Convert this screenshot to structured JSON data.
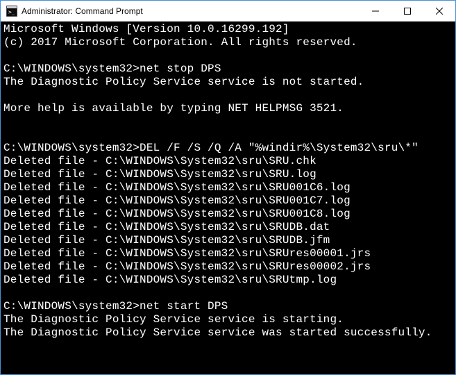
{
  "window": {
    "title": "Administrator: Command Prompt",
    "icon_alt": "cmd-icon"
  },
  "terminal": {
    "lines": [
      "Microsoft Windows [Version 10.0.16299.192]",
      "(c) 2017 Microsoft Corporation. All rights reserved.",
      "",
      "C:\\WINDOWS\\system32>net stop DPS",
      "The Diagnostic Policy Service service is not started.",
      "",
      "More help is available by typing NET HELPMSG 3521.",
      "",
      "",
      "C:\\WINDOWS\\system32>DEL /F /S /Q /A \"%windir%\\System32\\sru\\*\"",
      "Deleted file - C:\\WINDOWS\\System32\\sru\\SRU.chk",
      "Deleted file - C:\\WINDOWS\\System32\\sru\\SRU.log",
      "Deleted file - C:\\WINDOWS\\System32\\sru\\SRU001C6.log",
      "Deleted file - C:\\WINDOWS\\System32\\sru\\SRU001C7.log",
      "Deleted file - C:\\WINDOWS\\System32\\sru\\SRU001C8.log",
      "Deleted file - C:\\WINDOWS\\System32\\sru\\SRUDB.dat",
      "Deleted file - C:\\WINDOWS\\System32\\sru\\SRUDB.jfm",
      "Deleted file - C:\\WINDOWS\\System32\\sru\\SRUres00001.jrs",
      "Deleted file - C:\\WINDOWS\\System32\\sru\\SRUres00002.jrs",
      "Deleted file - C:\\WINDOWS\\System32\\sru\\SRUtmp.log",
      "",
      "C:\\WINDOWS\\system32>net start DPS",
      "The Diagnostic Policy Service service is starting.",
      "The Diagnostic Policy Service service was started successfully."
    ]
  }
}
